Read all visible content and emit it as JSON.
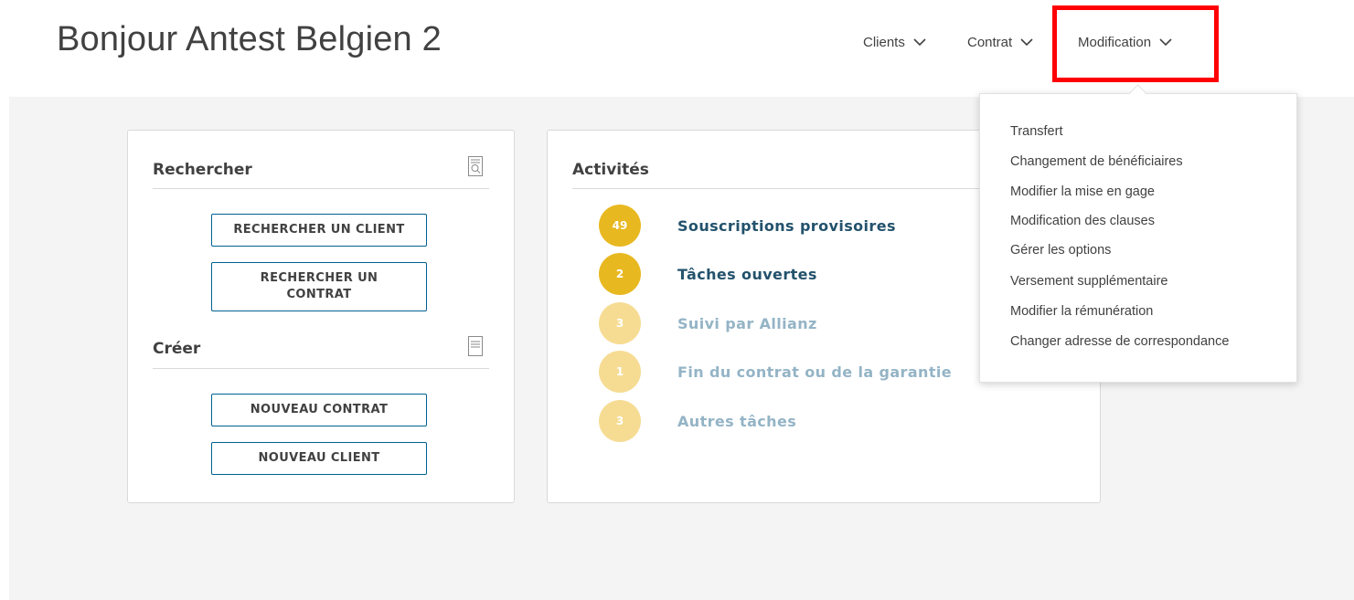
{
  "header": {
    "greeting": "Bonjour Antest Belgien 2",
    "nav": [
      {
        "label": "Clients",
        "icon": "chevron-down-icon"
      },
      {
        "label": "Contrat",
        "icon": "chevron-down-icon"
      },
      {
        "label": "Modification",
        "icon": "chevron-down-icon"
      }
    ],
    "highlight_color": "#ff0000"
  },
  "search_card": {
    "title": "Rechercher",
    "title_icon": "search-document-icon",
    "buttons": [
      "RECHERCHER UN CLIENT",
      "RECHERCHER UN CONTRAT"
    ],
    "create_title": "Créer",
    "create_icon": "document-icon",
    "create_buttons": [
      "NOUVEAU CONTRAT",
      "NOUVEAU CLIENT"
    ]
  },
  "activities": {
    "title": "Activités",
    "items": [
      {
        "count": "49",
        "label": "Souscriptions provisoires",
        "active": true
      },
      {
        "count": "2",
        "label": "Tâches ouvertes",
        "active": true
      },
      {
        "count": "3",
        "label": "Suivi par Allianz",
        "active": false
      },
      {
        "count": "1",
        "label": "Fin du contrat ou de la garantie",
        "active": false
      },
      {
        "count": "3",
        "label": "Autres tâches",
        "active": false
      }
    ]
  },
  "modification_menu": {
    "items": [
      "Transfert",
      "Changement de bénéficiaires",
      "Modifier la mise en gage",
      "Modification des clauses",
      "Gérer les options",
      "Versement supplémentaire",
      "Modifier la rémunération",
      "Changer adresse de correspondance"
    ]
  },
  "colors": {
    "badge_active": "#e8b820",
    "badge_inactive": "#f6dc93",
    "label_active": "#23526c",
    "label_inactive": "#94b4c6",
    "button_border": "#006192"
  }
}
